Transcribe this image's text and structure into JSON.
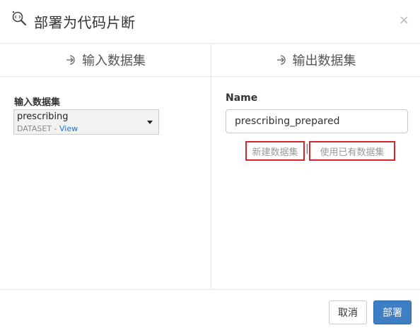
{
  "dialog": {
    "title": "部署为代码片断",
    "close_glyph": "×"
  },
  "input_column": {
    "header": "输入数据集",
    "label": "输入数据集",
    "dataset": {
      "name": "prescribing",
      "type": "DATASET",
      "separator": "-",
      "view_label": "View"
    }
  },
  "output_column": {
    "header": "输出数据集",
    "name_label": "Name",
    "name_value": "prescribing_prepared",
    "new_dataset_label": "新建数据集",
    "separator": "|",
    "use_existing_label": "使用已有数据集"
  },
  "footer": {
    "cancel_label": "取消",
    "deploy_label": "部署"
  },
  "colors": {
    "accent_blue": "#3d7ec4",
    "highlight_red": "#d9232e",
    "link_blue": "#2a73b8"
  },
  "icons": {
    "header": "search-code-icon",
    "column_header": "arrow-in-icon",
    "dropdown": "caret-down-icon"
  }
}
